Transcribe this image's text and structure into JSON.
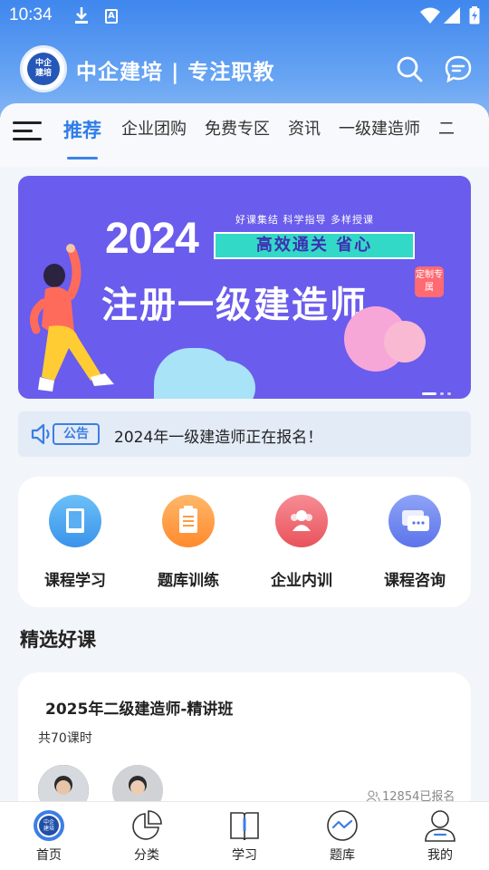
{
  "status_bar": {
    "time": "10:34",
    "a_icon": "A"
  },
  "header": {
    "logo_text_line1": "中企",
    "logo_text_line2": "建培",
    "title": "中企建培 | 专注职教",
    "icons": [
      "search-icon",
      "message-icon"
    ]
  },
  "tabs": {
    "items": [
      "推荐",
      "企业团购",
      "免费专区",
      "资讯",
      "一级建造师",
      "二"
    ],
    "active": "推荐",
    "accent": "#2f7de6"
  },
  "banner": {
    "year": "2024",
    "tags": "好课集结  科学指导  多样授课",
    "slogan": "高效通关  省心",
    "headline": "注册一级建造师",
    "badge": "定制专属",
    "background": "#6a5cec",
    "pages": 2,
    "current_page": 1
  },
  "notice": {
    "tag": "公告",
    "text": "2024年一级建造师正在报名！"
  },
  "quick_entries": [
    {
      "label": "课程学习",
      "icon": "book-icon",
      "color": "#4da8f2"
    },
    {
      "label": "题库训练",
      "icon": "clipboard-icon",
      "color": "#ffa04a"
    },
    {
      "label": "企业内训",
      "icon": "people-icon",
      "color": "#f2727a"
    },
    {
      "label": "课程咨询",
      "icon": "chat-icon",
      "color": "#6f86f0"
    }
  ],
  "section": {
    "title": "精选好课"
  },
  "course": {
    "title": "2025年二级建造师-精讲班",
    "lessons": "共70课时",
    "enrolled": "12854已报名"
  },
  "bottom_nav": [
    {
      "label": "首页",
      "icon": "home-logo-icon",
      "active": true
    },
    {
      "label": "分类",
      "icon": "pie-chart-icon",
      "active": false
    },
    {
      "label": "学习",
      "icon": "open-book-icon",
      "active": false
    },
    {
      "label": "题库",
      "icon": "trend-icon",
      "active": false
    },
    {
      "label": "我的",
      "icon": "user-icon",
      "active": false
    }
  ]
}
